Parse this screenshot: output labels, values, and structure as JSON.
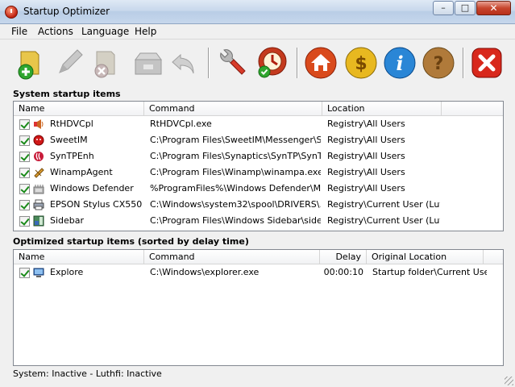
{
  "window": {
    "title": "Startup Optimizer",
    "minimize_glyph": "–",
    "maximize_glyph": "□",
    "close_glyph": "✕"
  },
  "menu": {
    "file": "File",
    "actions": "Actions",
    "language": "Language",
    "help": "Help"
  },
  "toolbar": {
    "buttons": [
      "add-icon",
      "edit-icon",
      "delete-icon",
      "restore-icon",
      "undo-icon",
      "tools-icon",
      "optimize-icon",
      "home-icon",
      "donate-icon",
      "info-icon",
      "help-icon",
      "exit-icon"
    ]
  },
  "system_section": {
    "label": "System startup items",
    "columns": [
      "Name",
      "Command",
      "Location"
    ],
    "rows": [
      {
        "name": "RtHDVCpl",
        "command": "RtHDVCpl.exe",
        "location": "Registry\\All Users",
        "icon": "speaker-icon"
      },
      {
        "name": "SweetIM",
        "command": "C:\\Program Files\\SweetIM\\Messenger\\S...",
        "location": "Registry\\All Users",
        "icon": "sweetim-icon"
      },
      {
        "name": "SynTPEnh",
        "command": "C:\\Program Files\\Synaptics\\SynTP\\SynT...",
        "location": "Registry\\All Users",
        "icon": "synaptics-icon"
      },
      {
        "name": "WinampAgent",
        "command": "C:\\Program Files\\Winamp\\winampa.exe",
        "location": "Registry\\All Users",
        "icon": "winamp-icon"
      },
      {
        "name": "Windows Defender",
        "command": "%ProgramFiles%\\Windows Defender\\MS...",
        "location": "Registry\\All Users",
        "icon": "defender-icon"
      },
      {
        "name": "EPSON Stylus CX550...",
        "command": "C:\\Windows\\system32\\spool\\DRIVERS\\...",
        "location": "Registry\\Current User (Luthfi)",
        "icon": "printer-icon"
      },
      {
        "name": "Sidebar",
        "command": "C:\\Program Files\\Windows Sidebar\\sideb...",
        "location": "Registry\\Current User (Luthfi)",
        "icon": "sidebar-icon"
      }
    ]
  },
  "optimized_section": {
    "label": "Optimized startup items (sorted by delay time)",
    "columns": [
      "Name",
      "Command",
      "Delay",
      "Original Location"
    ],
    "rows": [
      {
        "name": "Explore",
        "command": "C:\\Windows\\explorer.exe",
        "delay": "00:00:10",
        "location": "Startup folder\\Current Use...",
        "icon": "explorer-icon"
      }
    ]
  },
  "status": "System: Inactive - Luthfi: Inactive",
  "colors": {
    "titlebar": "#c8d8ec",
    "panel": "#f0f0f0",
    "check": "#1a8a1a",
    "close": "#c7462e"
  }
}
